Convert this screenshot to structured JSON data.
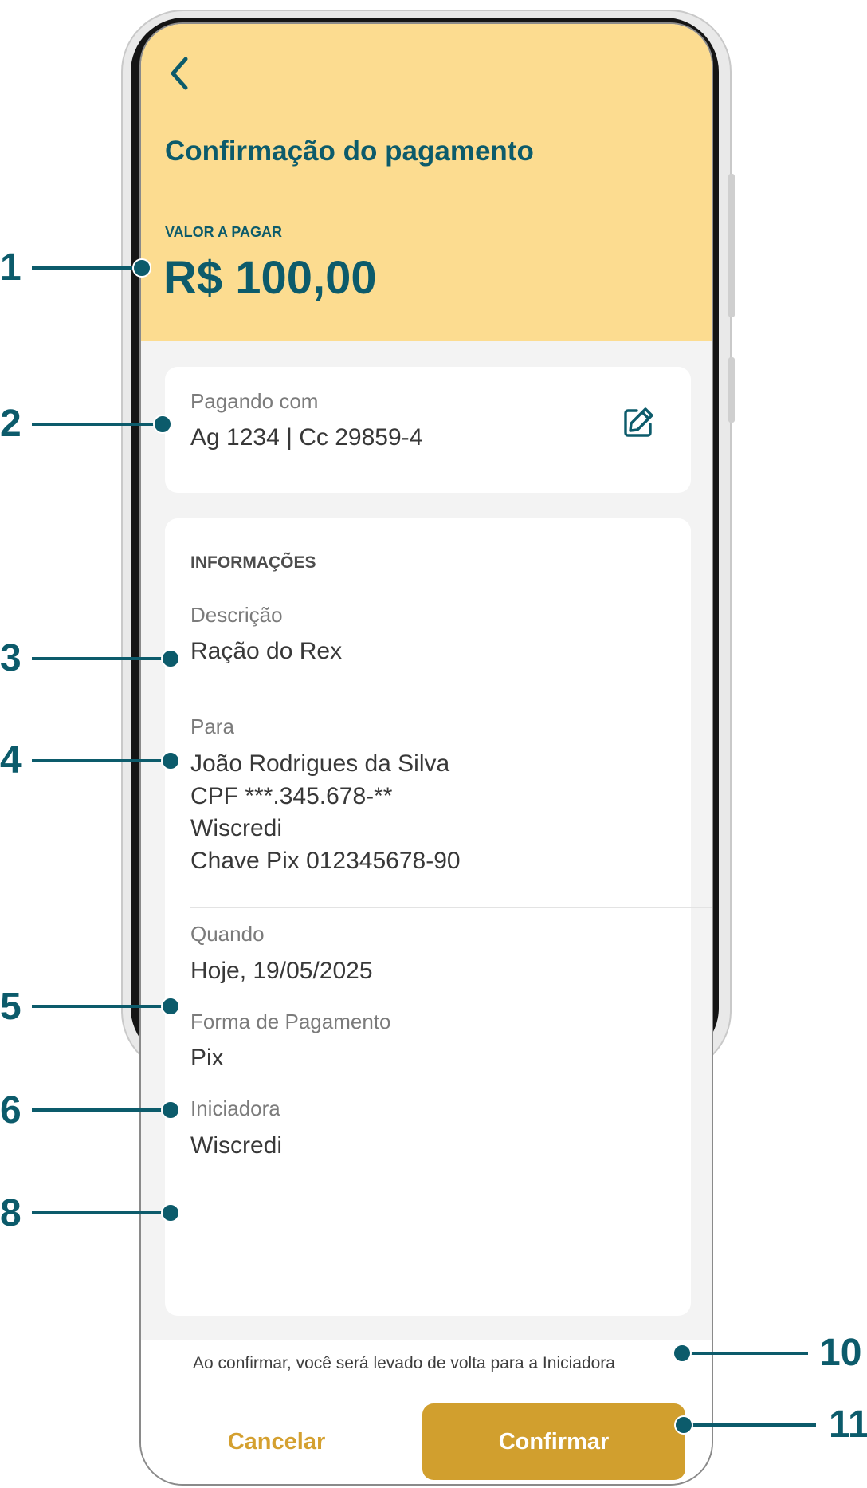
{
  "header": {
    "title": "Confirmação do pagamento",
    "amount_label": "VALOR A PAGAR",
    "amount_value": "R$ 100,00"
  },
  "payment_source": {
    "label": "Pagando com",
    "value": "Ag 1234 | Cc 29859-4"
  },
  "info": {
    "section_title": "INFORMAÇÕES",
    "description_label": "Descrição",
    "description_value": "Ração do Rex",
    "payee_label": "Para",
    "payee_name": "João Rodrigues da Silva",
    "payee_cpf": "CPF ***.345.678-**",
    "payee_institution": "Wiscredi",
    "payee_pix_key": "Chave Pix 012345678-90",
    "when_label": "Quando",
    "when_value": "Hoje, 19/05/2025",
    "method_label": "Forma de Pagamento",
    "method_value": "Pix",
    "initiator_label": "Iniciadora",
    "initiator_value": "Wiscredi"
  },
  "footer": {
    "notice": "Ao confirmar, você será levado de volta para a Iniciadora",
    "cancel_label": "Cancelar",
    "confirm_label": "Confirmar"
  },
  "annotations": [
    "1",
    "2",
    "3",
    "4",
    "5",
    "6",
    "8",
    "10",
    "11"
  ],
  "colors": {
    "header_bg": "#fcdc90",
    "primary_text": "#0c5b6b",
    "accent": "#d19f2e"
  }
}
